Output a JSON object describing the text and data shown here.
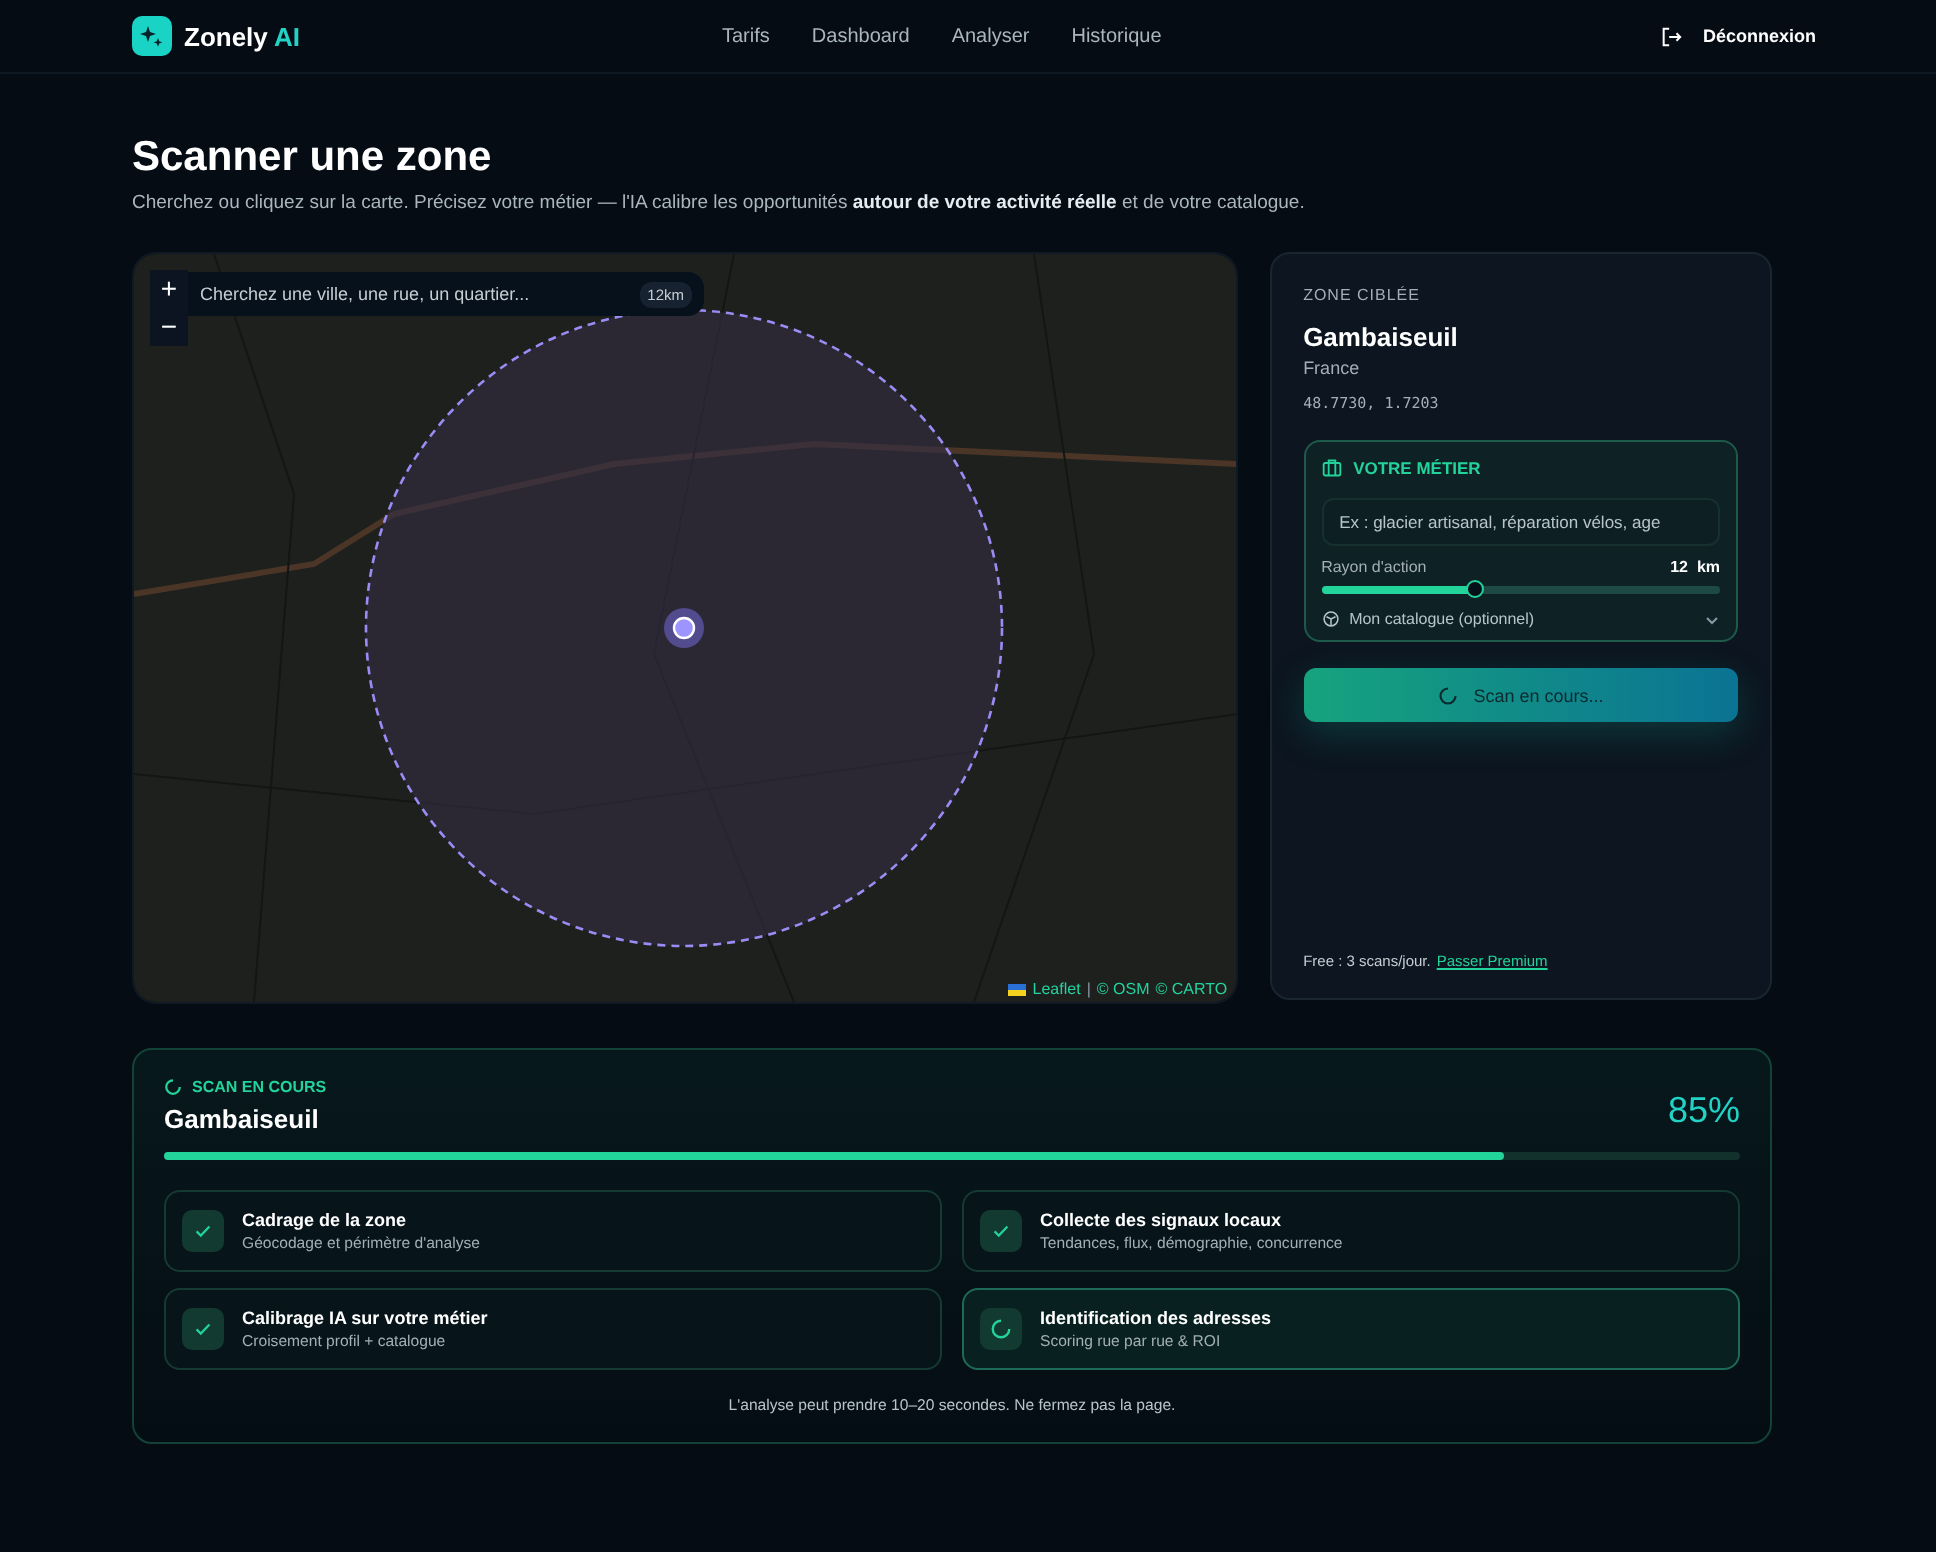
{
  "brand": {
    "name": "Zonely",
    "suffix": "AI"
  },
  "nav": [
    {
      "label": "Tarifs"
    },
    {
      "label": "Dashboard"
    },
    {
      "label": "Analyser"
    },
    {
      "label": "Historique"
    }
  ],
  "logout": "Déconnexion",
  "page": {
    "title": "Scanner une zone",
    "subtitle": "Cherchez ou cliquez sur la carte. Précisez votre métier — l'IA calibre les opportunités **autour de votre activité réelle** et de votre catalogue."
  },
  "map": {
    "zoom_in": "+",
    "zoom_out": "−",
    "search": {
      "placeholder": "Cherchez une ville, une rue, un quartier..."
    },
    "radius_badge": "12km",
    "attribution": [
      {
        "text": "Leaflet",
        "kind": "link"
      },
      {
        "text": "|",
        "kind": "separator"
      },
      {
        "text": "© OSM",
        "kind": "link"
      },
      {
        "text": "© CARTO",
        "kind": "link"
      }
    ]
  },
  "zone": {
    "label": "ZONE CIBLÉE",
    "name": "Gambaiseuil",
    "country": "France",
    "coords": "48.7730, 1.7203",
    "job": {
      "title": "VOTRE MÉTIER",
      "placeholder": "Ex : glacier artisanal, réparation vélos, age",
      "radius_label": "Rayon d'action",
      "radius_value": "12",
      "radius_unit": "km",
      "level": 0.39,
      "catalog": "Mon catalogue (optionnel)",
      "catalog_expanded": false
    },
    "scan_button": {
      "label": "Scan en cours...",
      "busy": true
    },
    "footer": "Free : 3 scans/jour.",
    "premium_link": "Passer Premium"
  },
  "scan": {
    "status": "SCAN EN COURS",
    "name": "Gambaiseuil",
    "percent": "85%",
    "level": 0.85,
    "steps": [
      {
        "title": "Cadrage de la zone",
        "detail": "Géocodage et périmètre d'analyse",
        "kind": "done"
      },
      {
        "title": "Collecte des signaux locaux",
        "detail": "Tendances, flux, démographie, concurrence",
        "kind": "done"
      },
      {
        "title": "Calibrage IA sur votre métier",
        "detail": "Croisement profil + catalogue",
        "kind": "done"
      },
      {
        "title": "Identification des adresses",
        "detail": "Scoring rue par rue & ROI",
        "kind": "running"
      }
    ],
    "note": "L'analyse peut prendre 10–20 secondes. Ne fermez pas la page."
  }
}
